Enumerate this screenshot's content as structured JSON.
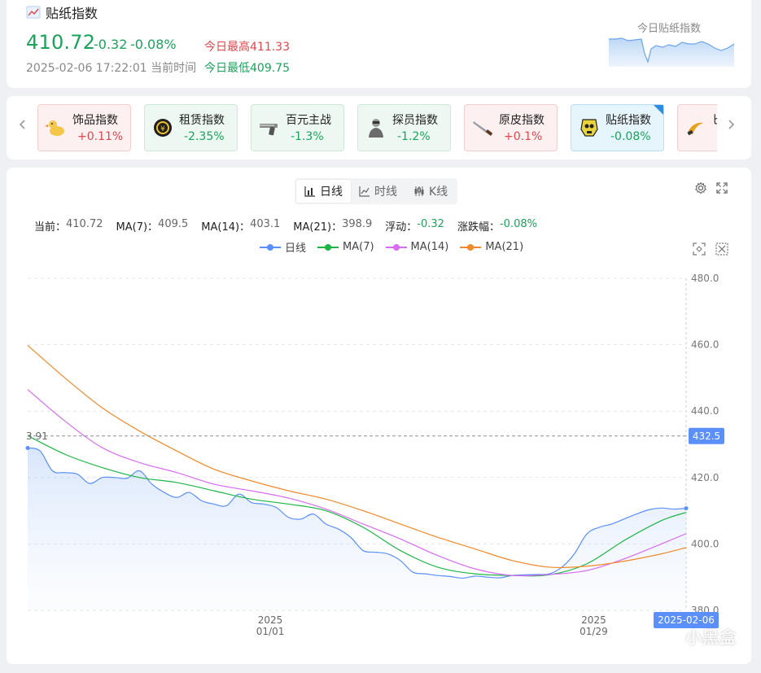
{
  "summary": {
    "title": "贴纸指数",
    "value": "410.72",
    "change": "-0.32",
    "change_pct": "-0.08%",
    "timestamp": "2025-02-06 17:22:01 当前时间",
    "high_label": "今日最高411.33",
    "low_label": "今日最低409.75",
    "mini_title": "今日贴纸指数",
    "colors": {
      "up": "#e0474c",
      "down": "#1aa35b"
    }
  },
  "indices": {
    "prev_icon": "chevron-left-icon",
    "next_icon": "chevron-right-icon",
    "items": [
      {
        "name": "饰品指数",
        "change": "+0.11%",
        "trend": "up",
        "icon": "duck-icon"
      },
      {
        "name": "租赁指数",
        "change": "-2.35%",
        "trend": "down",
        "icon": "rent-coin-icon"
      },
      {
        "name": "百元主战",
        "change": "-1.3%",
        "trend": "down",
        "icon": "pistol-icon"
      },
      {
        "name": "探员指数",
        "change": "-1.2%",
        "trend": "down",
        "icon": "agent-icon"
      },
      {
        "name": "原皮指数",
        "change": "+0.1%",
        "trend": "up",
        "icon": "knife-icon"
      },
      {
        "name": "贴纸指数",
        "change": "-0.08%",
        "trend": "active",
        "icon": "sticker-skull-icon"
      },
      {
        "name": "匕",
        "change": "",
        "trend": "up",
        "icon": "karambit-icon"
      }
    ]
  },
  "chart": {
    "tabs": [
      {
        "label": "日线",
        "icon": "bar-chart-icon",
        "active": true
      },
      {
        "label": "时线",
        "icon": "line-chart-icon",
        "active": false
      },
      {
        "label": "K线",
        "icon": "candlestick-icon",
        "active": false
      }
    ],
    "stats": {
      "current_label": "当前：",
      "current": "410.72",
      "ma7_label": "MA(7)：",
      "ma7": "409.5",
      "ma14_label": "MA(14)：",
      "ma14": "403.1",
      "ma21_label": "MA(21)：",
      "ma21": "398.9",
      "float_label": "浮动：",
      "float": "-0.32",
      "pct_label": "涨跌幅：",
      "pct": "-0.08%"
    },
    "crosshair_y_label": "432.5",
    "crosshair_left_label": "3.91",
    "crosshair_x_label": "2025-02-06",
    "watermark": "小黑盒"
  },
  "chart_data": {
    "type": "line",
    "x_start": "2024-12-11",
    "x_end": "2025-02-06",
    "x_ticks": [
      {
        "date": "2025-01-01",
        "label_top": "2025",
        "label_bottom": "01/01"
      },
      {
        "date": "2025-01-29",
        "label_top": "2025",
        "label_bottom": "01/29"
      }
    ],
    "ylim": [
      380,
      480
    ],
    "y_ticks": [
      "380.0",
      "400.0",
      "420.0",
      "440.0",
      "460.0",
      "480.0"
    ],
    "grid": true,
    "legend_position": "top",
    "series": [
      {
        "name": "日线",
        "color": "#5b8ff9",
        "area": true,
        "points": [
          [
            0,
            428.9
          ],
          [
            1,
            428
          ],
          [
            2,
            422
          ],
          [
            3,
            421.5
          ],
          [
            4,
            421
          ],
          [
            5,
            418.2
          ],
          [
            6,
            420
          ],
          [
            7,
            420
          ],
          [
            8,
            419.8
          ],
          [
            9,
            422
          ],
          [
            10,
            418
          ],
          [
            11,
            415.5
          ],
          [
            12,
            414
          ],
          [
            13,
            415.5
          ],
          [
            14,
            413
          ],
          [
            15,
            412
          ],
          [
            16,
            411.5
          ],
          [
            17,
            415
          ],
          [
            18,
            412.5
          ],
          [
            19,
            412
          ],
          [
            20,
            411
          ],
          [
            21,
            408
          ],
          [
            22,
            407.5
          ],
          [
            23,
            409
          ],
          [
            24,
            406
          ],
          [
            25,
            404.5
          ],
          [
            26,
            402
          ],
          [
            27,
            398
          ],
          [
            28,
            397.5
          ],
          [
            29,
            397
          ],
          [
            30,
            395
          ],
          [
            31,
            391.5
          ],
          [
            32,
            391
          ],
          [
            33,
            390.5
          ],
          [
            34,
            390.2
          ],
          [
            35,
            389.7
          ],
          [
            36,
            390.3
          ],
          [
            37,
            390
          ],
          [
            38,
            389.8
          ],
          [
            39,
            390.5
          ],
          [
            40,
            390.7
          ],
          [
            41,
            390.8
          ],
          [
            42,
            391
          ],
          [
            43,
            393
          ],
          [
            44,
            397
          ],
          [
            45,
            403
          ],
          [
            46,
            405
          ],
          [
            47,
            406
          ],
          [
            48,
            407.5
          ],
          [
            49,
            409
          ],
          [
            50,
            410.3
          ],
          [
            51,
            410.8
          ],
          [
            52,
            410.5
          ],
          [
            53,
            410.72
          ]
        ]
      },
      {
        "name": "MA(7)",
        "color": "#1db546",
        "points": [
          [
            0,
            432.6
          ],
          [
            3,
            427
          ],
          [
            6,
            423
          ],
          [
            9,
            420
          ],
          [
            12,
            418.5
          ],
          [
            15,
            416
          ],
          [
            18,
            413.5
          ],
          [
            21,
            412
          ],
          [
            24,
            410
          ],
          [
            27,
            405
          ],
          [
            30,
            398
          ],
          [
            33,
            393
          ],
          [
            36,
            391
          ],
          [
            39,
            390.5
          ],
          [
            42,
            390.7
          ],
          [
            45,
            394
          ],
          [
            48,
            401
          ],
          [
            51,
            407
          ],
          [
            53,
            409.5
          ]
        ]
      },
      {
        "name": "MA(14)",
        "color": "#d96bf2",
        "points": [
          [
            0,
            446.5
          ],
          [
            3,
            437
          ],
          [
            6,
            429
          ],
          [
            9,
            424.5
          ],
          [
            12,
            421.5
          ],
          [
            15,
            418
          ],
          [
            18,
            416
          ],
          [
            21,
            413.8
          ],
          [
            24,
            410.5
          ],
          [
            27,
            406
          ],
          [
            30,
            401.5
          ],
          [
            33,
            396.5
          ],
          [
            36,
            392.5
          ],
          [
            39,
            390.5
          ],
          [
            42,
            390.8
          ],
          [
            45,
            392
          ],
          [
            48,
            395.5
          ],
          [
            51,
            400
          ],
          [
            53,
            403.1
          ]
        ]
      },
      {
        "name": "MA(21)",
        "color": "#f08a2a",
        "points": [
          [
            0,
            459.8
          ],
          [
            3,
            450
          ],
          [
            6,
            441
          ],
          [
            9,
            434
          ],
          [
            12,
            428
          ],
          [
            15,
            422.5
          ],
          [
            18,
            419
          ],
          [
            21,
            416
          ],
          [
            24,
            413.5
          ],
          [
            27,
            410
          ],
          [
            30,
            406
          ],
          [
            33,
            402
          ],
          [
            36,
            398.5
          ],
          [
            39,
            395
          ],
          [
            42,
            393
          ],
          [
            45,
            393.3
          ],
          [
            48,
            394.8
          ],
          [
            51,
            397
          ],
          [
            53,
            398.9
          ]
        ]
      }
    ]
  }
}
